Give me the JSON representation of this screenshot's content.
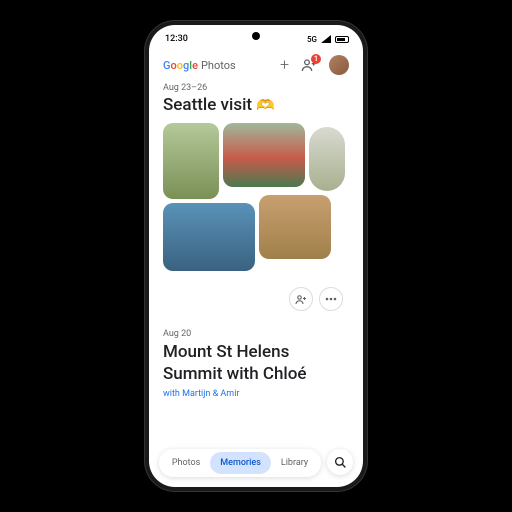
{
  "statusbar": {
    "time": "12:30",
    "network": "5G"
  },
  "header": {
    "logo_word": "Photos",
    "share_badge": "1"
  },
  "memory1": {
    "date": "Aug 23–26",
    "title": "Seattle visit",
    "emoji": "🫶"
  },
  "memory2": {
    "date": "Aug 20",
    "title_line1": "Mount St Helens",
    "title_line2": "Summit with Chloé",
    "subtitle": "with Martijn & Amir"
  },
  "nav": {
    "photos": "Photos",
    "memories": "Memories",
    "library": "Library"
  }
}
